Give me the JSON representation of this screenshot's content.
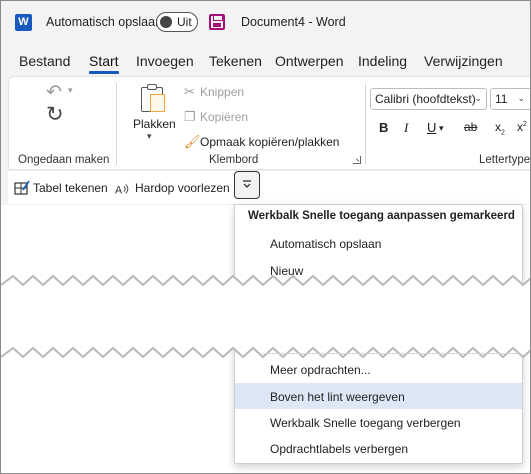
{
  "titlebar": {
    "app_icon": "word-logo-icon",
    "app_letter": "W",
    "autosave_label": "Automatisch opslaan",
    "autosave_state": "Uit",
    "save_icon": "save-icon",
    "doc_title": "Document4  -  Word"
  },
  "tabs": [
    "Bestand",
    "Start",
    "Invoegen",
    "Tekenen",
    "Ontwerpen",
    "Indeling",
    "Verwijzingen"
  ],
  "active_tab": "Start",
  "ribbon": {
    "undo_group_label": "Ongedaan maken",
    "paste_label": "Plakken",
    "cut_label": "Knippen",
    "copy_label": "Kopiëren",
    "format_painter_label": "Opmaak kopiëren/plakken",
    "clipboard_group_label": "Klembord",
    "font_name": "Calibri (hoofdtekst)",
    "font_size": "11",
    "bold": "B",
    "italic": "I",
    "underline": "U",
    "strikethrough": "ab",
    "subscript": "x",
    "subscript_mark": "2",
    "superscript": "x",
    "superscript_mark": "2",
    "font_group_label": "Lettertype"
  },
  "qat": {
    "draw_table_label": "Tabel tekenen",
    "read_aloud_label": "Hardop voorlezen",
    "dropdown_icon": "customize-dropdown-icon"
  },
  "menu": {
    "header": "Werkbalk Snelle toegang aanpassen gemarkeerd",
    "items": [
      "Automatisch opslaan",
      "Nieuw"
    ],
    "bottom_items": [
      "Meer opdrachten...",
      "Boven het lint weergeven",
      "Werkbalk Snelle toegang verbergen",
      "Opdrachtlabels verbergen"
    ],
    "highlighted": "Boven het lint weergeven"
  },
  "colors": {
    "accent": "#185abd",
    "save_purple": "#a4107a",
    "menu_highlight": "#dde7f5",
    "chrome_bg": "#f3f3f3"
  }
}
